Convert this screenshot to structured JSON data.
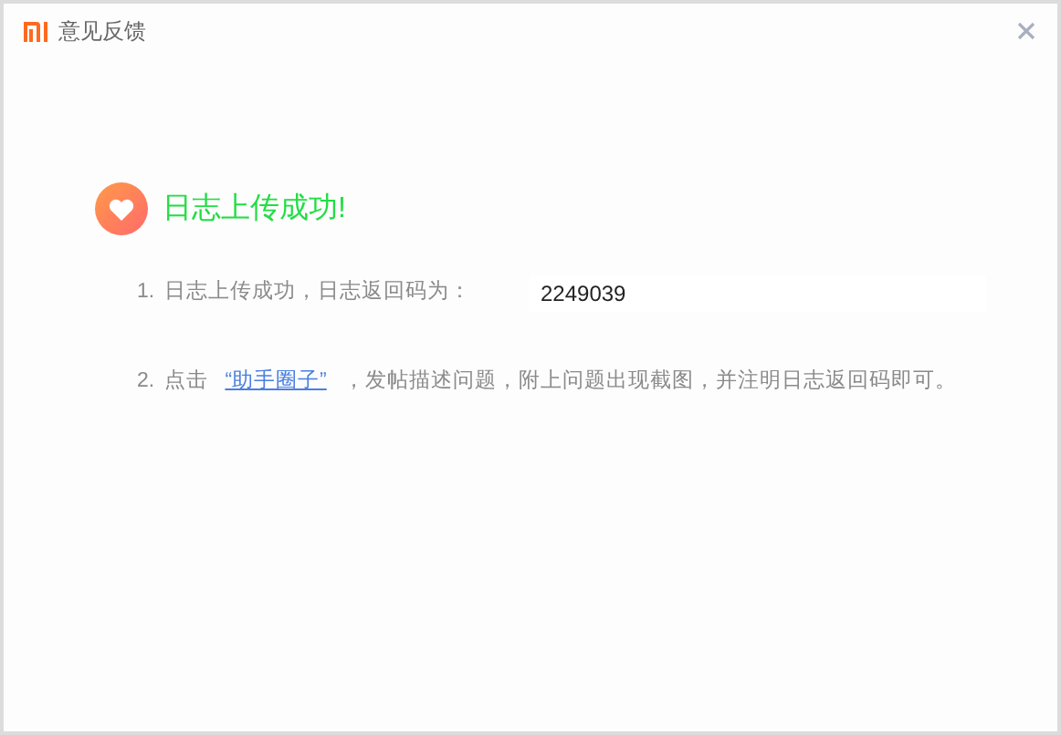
{
  "window": {
    "title": "意见反馈"
  },
  "result": {
    "heading": "日志上传成功!"
  },
  "steps": [
    {
      "kind": "code",
      "number": "1.",
      "text": "日志上传成功，日志返回码为：",
      "value": "2249039"
    },
    {
      "kind": "link",
      "number": "2.",
      "text_before": "点击",
      "link": "“助手圈子”",
      "text_after": "，发帖描述问题，附上问题出现截图，并注明日志返回码即可。"
    }
  ]
}
